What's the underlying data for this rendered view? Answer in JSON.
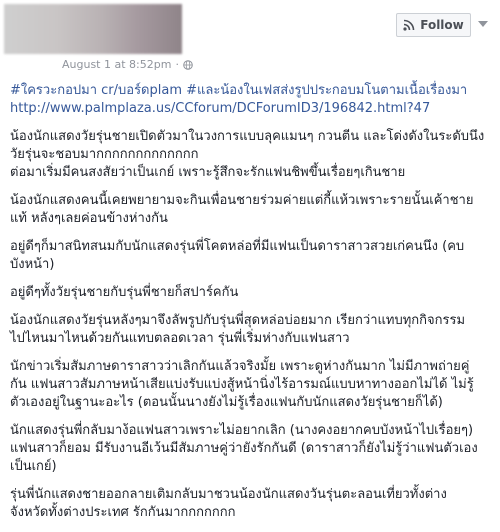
{
  "post": {
    "timestamp": "August 1 at 8:52pm",
    "follow_label": "Follow",
    "hashtags_line_1": "#ใครวะกอปมา cr/บอร์ดplam #และน้องในเฟสส่งรูปประกอบมโนตามเนื้อเรื่องมา",
    "link": "http://www.palmplaza.us/CCforum/DCForumID3/196842.html?47",
    "paragraphs": [
      {
        "lines": [
          "น้องนักแสดงวัยรุ่นชายเปิดตัวมาในวงการแบบลุคแมนๆ กวนตีน และโด่งดังในระดับนึง",
          "วัยรุ่นจะชอบมากกกกกกกกกกกกก",
          "ต่อมาเริ่มมีคนสงสัยว่าเป็นเกย์ เพราะรู้สึกจะรักแฟนชิพขึ้นเรื่อยๆเกินชาย"
        ]
      },
      {
        "lines": [
          "น้องนักแสดงคนนี้เคยพยายามจะกินเพื่อนชายร่วมค่ายแต่กี้แห้วเพราะรายนั้นเค้าชาย",
          "แท้ หลังๆเลยค่อนข้างห่างกัน"
        ]
      },
      {
        "lines": [
          "อยู่ดีๆก็มาสนิทสนมกับนักแสดงรุ่นพี่โคตหล่อที่มีแฟนเป็นดาราสาวสวยเก่คนนึง (คบ",
          "บังหน้า)"
        ]
      },
      {
        "lines": [
          "อยู่ดีๆทั้งวัยรุ่นชายกับรุ่นพี่ชายก็สปาร์คกัน"
        ]
      },
      {
        "lines": [
          "น้องนักแสดงวัยรุ่นหลังๆมาจึงลัพรูปกับรุ่นพี่สุดหล่อบ่อยมาก เรียกว่าแทบทุกกิจกรรม",
          "ไปไหนมาไหนด้วยกันแทบตลอดเวลา รุ่นพี่เริ่มห่างกับแฟนสาว"
        ]
      },
      {
        "lines": [
          "นักข่าวเริ่มสัมภาษดาราสาวว่าเลิกกันแล้วจริงมั้ย เพราะดูห่างกันมาก ไม่มีภาพถ่ายคู่",
          "กัน แฟนสาวสัมภาษหน้าเสียแบ่งรับแบ่งสู้หน้านิ่งไร้อารมณ์แบบหาทางออกไม่ได้ ไม่รู้",
          "ตัวเองอยู่ในฐานะอะไร (ตอนนั้นนางยังไม่รู้เรื่องแฟนกับนักแสดงวัยรุ่นชายก็ได้)"
        ]
      },
      {
        "lines": [
          "นักแสดงรุ่นพี่กลับมาง้อแฟนสาวเพราะไม่อยากเลิก (นางคงอยากคบบังหน้าไปเรื่อยๆ)",
          "แฟนสาวก็ยอม มีรับงานอีเว้นมีสัมภาษคู่ว่ายังรักกันดี (ดาราสาวก็ยังไม่รู้ว่าแฟนตัวเอง",
          "เป็นเกย์)"
        ]
      },
      {
        "lines": [
          "รุ่นพี่นักแสดงชายออกลายเติมกลับมาชวนน้องนักแสดงวันรุ่นตะลอนเที่ยวทั้งต่าง",
          "จังหวัดทั้งต่างประเทศ รักกันมากกกกกกก"
        ]
      }
    ]
  },
  "icons": {
    "follow_icon": "rss-icon",
    "privacy_icon": "globe-icon",
    "menu_icon": "chevron-down-icon"
  },
  "colors": {
    "link": "#365899",
    "meta": "#90949c",
    "text": "#1d2129"
  }
}
